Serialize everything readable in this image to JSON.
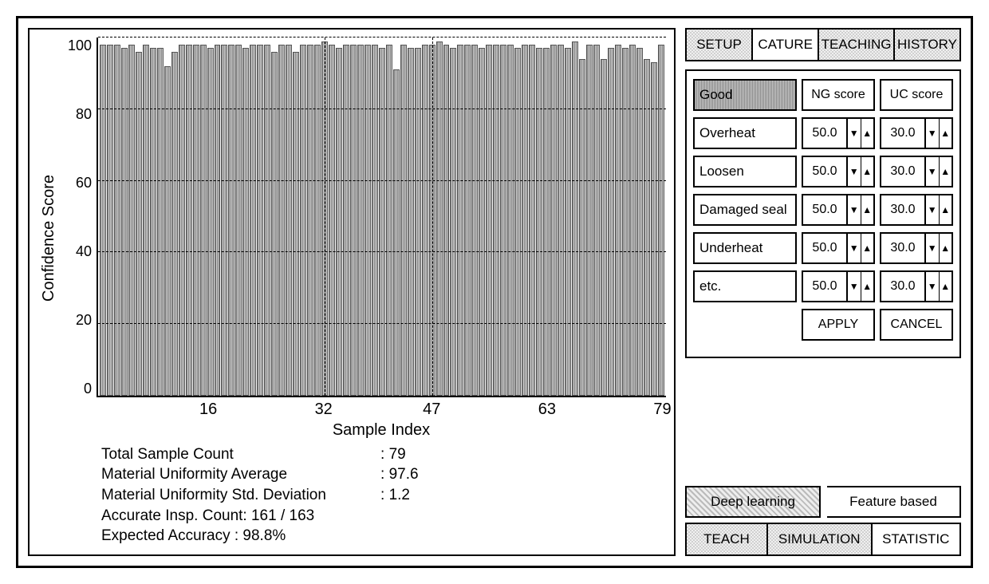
{
  "chart_data": {
    "type": "bar",
    "xlabel": "Sample Index",
    "ylabel": "Confidence Score",
    "ylim": [
      0,
      100
    ],
    "yticks": [
      100,
      80,
      60,
      40,
      20,
      0
    ],
    "xticks": [
      16,
      32,
      47,
      63,
      79
    ],
    "gridlines_h": [
      20,
      40,
      60,
      80,
      100
    ],
    "gridlines_v": [
      32,
      47
    ],
    "values": [
      98,
      98,
      98,
      97,
      98,
      96,
      98,
      97,
      97,
      92,
      96,
      98,
      98,
      98,
      98,
      97,
      98,
      98,
      98,
      98,
      97,
      98,
      98,
      98,
      96,
      98,
      98,
      96,
      98,
      98,
      98,
      99,
      98,
      97,
      98,
      98,
      98,
      98,
      98,
      97,
      98,
      91,
      98,
      97,
      97,
      98,
      98,
      99,
      98,
      97,
      98,
      98,
      98,
      97,
      98,
      98,
      98,
      98,
      97,
      98,
      98,
      97,
      97,
      98,
      98,
      97,
      99,
      94,
      98,
      98,
      94,
      97,
      98,
      97,
      98,
      97,
      94,
      93,
      98
    ]
  },
  "stats": {
    "total_sample_count": {
      "label": "Total Sample Count",
      "value": "79"
    },
    "uniformity_avg": {
      "label": "Material Uniformity Average",
      "value": "97.6"
    },
    "uniformity_std": {
      "label": "Material Uniformity Std. Deviation",
      "value": "1.2"
    },
    "accurate_insp": {
      "label_full": "Accurate Insp. Count: 161 / 163",
      "label": "Accurate Insp. Count",
      "value": "161 / 163"
    },
    "expected_acc": {
      "label_full": "Expected Accuracy   : 98.8%",
      "label": "Expected Accuracy",
      "value": "98.8%"
    }
  },
  "tabs_top": [
    "SETUP",
    "CATURE",
    "TEACHING",
    "HISTORY"
  ],
  "settings": {
    "header_first": "Good",
    "score_headers": [
      "NG score",
      "UC score"
    ],
    "rows": [
      {
        "name": "Overheat",
        "ng": "50.0",
        "uc": "30.0"
      },
      {
        "name": "Loosen",
        "ng": "50.0",
        "uc": "30.0"
      },
      {
        "name": "Damaged seal",
        "ng": "50.0",
        "uc": "30.0"
      },
      {
        "name": "Underheat",
        "ng": "50.0",
        "uc": "30.0"
      },
      {
        "name": "etc.",
        "ng": "50.0",
        "uc": "30.0"
      }
    ],
    "apply": "APPLY",
    "cancel": "CANCEL"
  },
  "mode_tabs": [
    "Deep learning",
    "Feature based"
  ],
  "tabs_bottom": [
    "TEACH",
    "SIMULATION",
    "STATISTIC"
  ]
}
